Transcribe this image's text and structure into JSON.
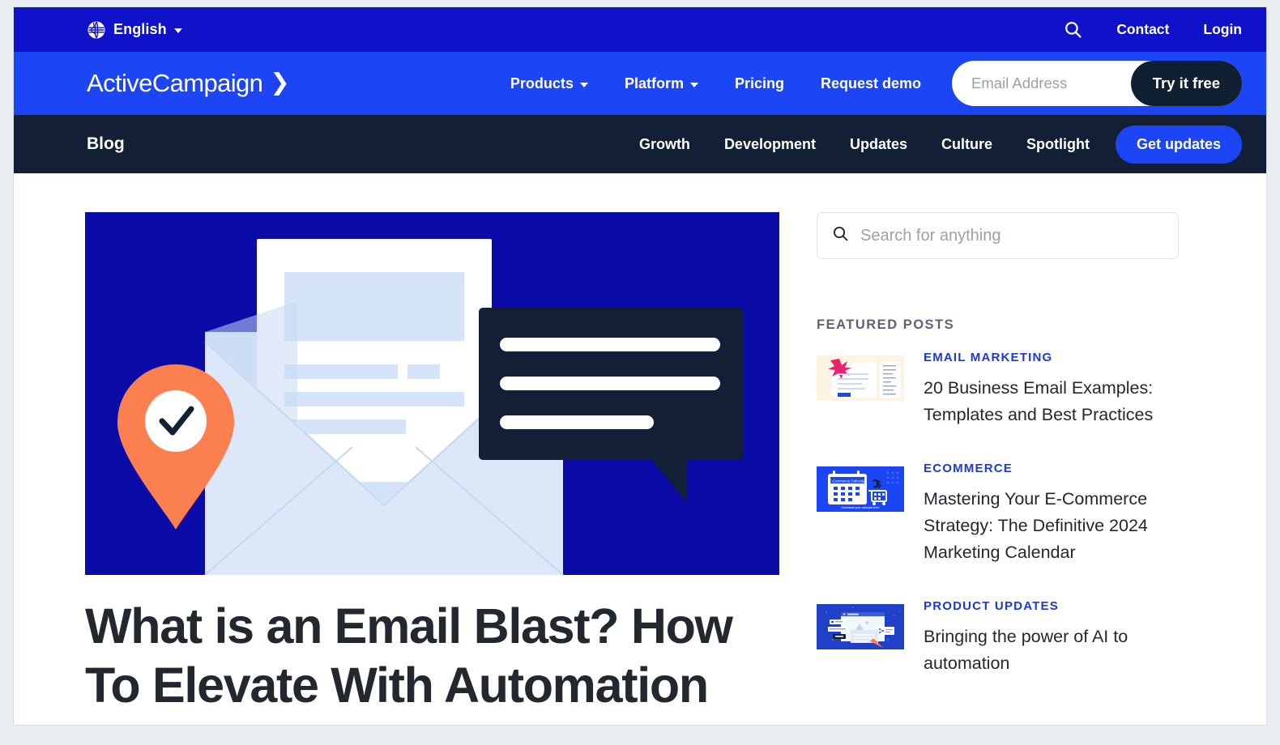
{
  "utility_bar": {
    "language": "English",
    "globe_icon": "globe-icon",
    "caret_icon": "chevron-down-icon",
    "search_icon": "search-icon",
    "links": [
      {
        "label": "Contact"
      },
      {
        "label": "Login"
      }
    ]
  },
  "main_nav": {
    "brand": "ActiveCampaign",
    "brand_chevron": "»",
    "items": [
      {
        "label": "Products",
        "has_dropdown": true
      },
      {
        "label": "Platform",
        "has_dropdown": true
      },
      {
        "label": "Pricing",
        "has_dropdown": false
      },
      {
        "label": "Request demo",
        "has_dropdown": false
      }
    ],
    "email_placeholder": "Email Address",
    "email_value": "",
    "cta_label": "Try it free"
  },
  "blog_nav": {
    "brand": "Blog",
    "categories": [
      {
        "label": "Growth"
      },
      {
        "label": "Development"
      },
      {
        "label": "Updates"
      },
      {
        "label": "Culture"
      },
      {
        "label": "Spotlight"
      }
    ],
    "cta_label": "Get updates"
  },
  "article": {
    "title": "What is an Email Blast? How To Elevate With Automation",
    "hero_illustration": "email-envelope-illustration"
  },
  "sidebar": {
    "search_placeholder": "Search for anything",
    "search_value": "",
    "search_icon": "search-icon",
    "featured_heading": "FEATURED POSTS",
    "posts": [
      {
        "category": "EMAIL MARKETING",
        "title": "20 Business Email Examples: Templates and Best Practices",
        "thumb": "email-template-thumbnail"
      },
      {
        "category": "ECOMMERCE",
        "title": "Mastering Your E-Commerce Strategy: The Definitive 2024 Marketing Calendar",
        "thumb": "ecommerce-calendar-thumbnail"
      },
      {
        "category": "PRODUCT UPDATES",
        "title": "Bringing the power of AI to automation",
        "thumb": "ai-automation-thumbnail"
      }
    ]
  },
  "colors": {
    "utility_bar": "#0f12c9",
    "main_nav": "#1b45f5",
    "blog_nav": "#121f35",
    "hero_bg": "#0b0ba8",
    "accent_orange": "#fc7f50",
    "dark_navy": "#121f35",
    "category_blue": "#1b38d8",
    "envelope_light": "#dce8fa",
    "cta_dark": "#102032"
  }
}
